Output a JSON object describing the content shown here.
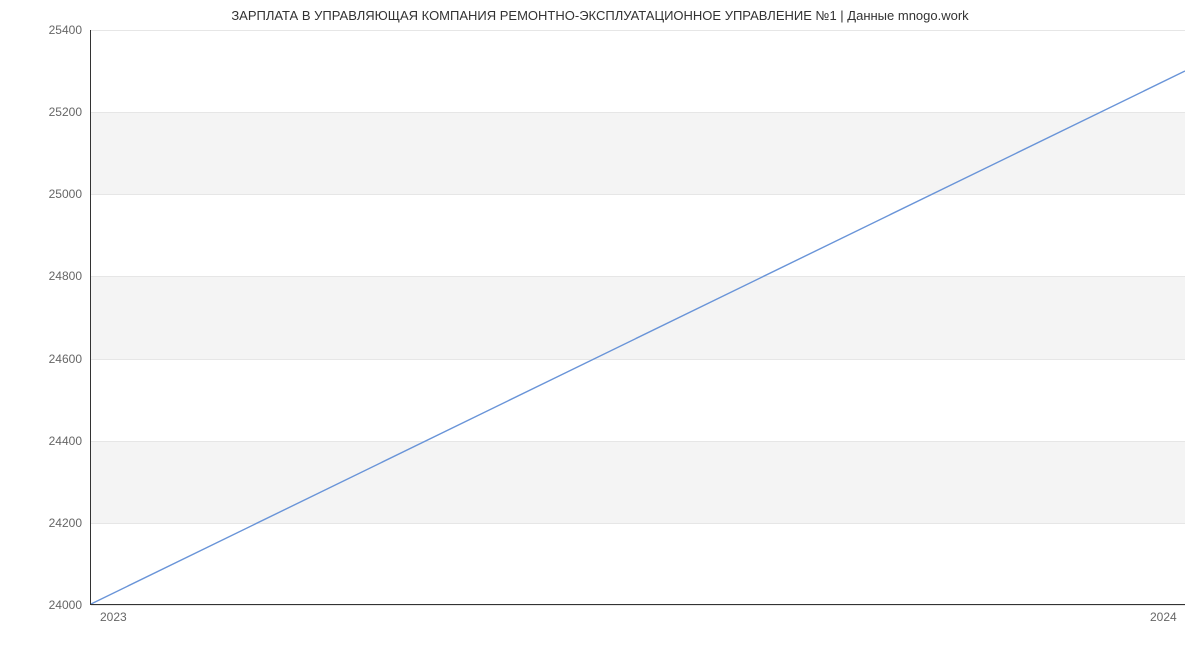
{
  "chart_data": {
    "type": "line",
    "title": "ЗАРПЛАТА В  УПРАВЛЯЮЩАЯ КОМПАНИЯ РЕМОНТНО-ЭКСПЛУАТАЦИОННОЕ УПРАВЛЕНИЕ №1 | Данные mnogo.work",
    "x": [
      2023,
      2024
    ],
    "values": [
      24000,
      25300
    ],
    "xticks": [
      "2023",
      "2024"
    ],
    "yticks": [
      24000,
      24200,
      24400,
      24600,
      24800,
      25000,
      25200,
      25400
    ],
    "xlim": [
      2023,
      2024
    ],
    "ylim": [
      24000,
      25400
    ],
    "xlabel": "",
    "ylabel": "",
    "line_color": "#6994d8"
  }
}
